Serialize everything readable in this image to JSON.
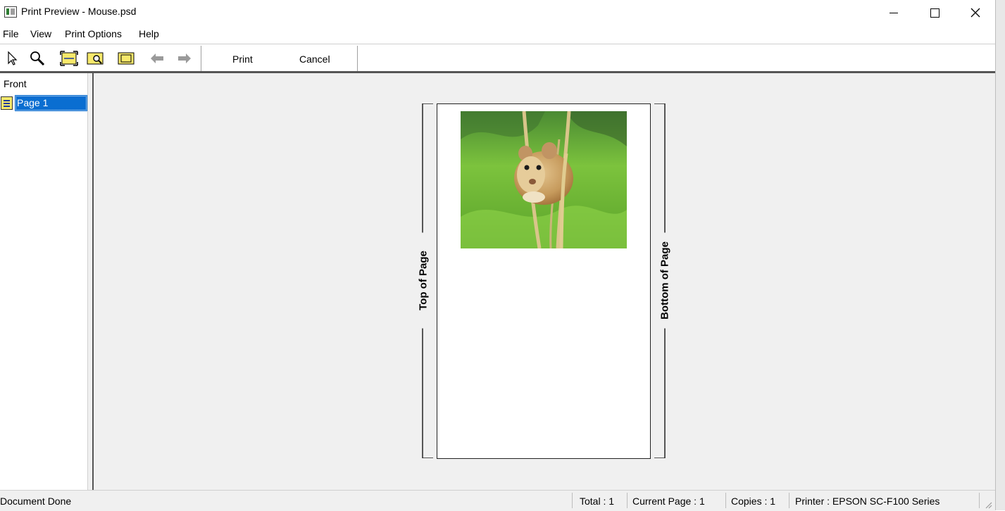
{
  "window": {
    "title": "Print Preview - Mouse.psd",
    "minimize_icon": "minimize-icon",
    "maximize_icon": "maximize-icon",
    "close_icon": "close-icon"
  },
  "menu": {
    "items": [
      "File",
      "View",
      "Print Options",
      "Help"
    ]
  },
  "toolbar": {
    "tools": [
      "select-arrow-icon",
      "zoom-icon",
      "fit-width-icon",
      "fit-page-icon",
      "page-border-icon",
      "back-arrow-icon",
      "forward-arrow-icon"
    ],
    "print_label": "Print",
    "cancel_label": "Cancel"
  },
  "tree": {
    "root_label": "Front",
    "pages": [
      {
        "label": "Page 1",
        "selected": true,
        "icon": "page-icon"
      }
    ]
  },
  "preview": {
    "top_label": "Top of Page",
    "bottom_label": "Bottom of Page",
    "image_subject": "harvest mouse on grass stems"
  },
  "status": {
    "message": "Document Done",
    "total": "Total : 1",
    "current_page": "Current Page : 1",
    "copies": "Copies : 1",
    "printer": "Printer : EPSON SC-F100 Series"
  },
  "colors": {
    "selection": "#0a6ed1",
    "preview_bg": "#f0f0f0",
    "accent_icon": "#f7e96b"
  }
}
